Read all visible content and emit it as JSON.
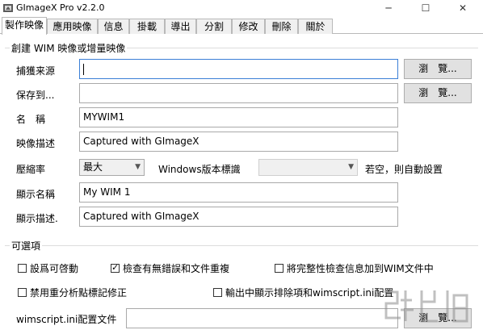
{
  "window": {
    "title": "GImageX Pro  v2.2.0",
    "minimize": "─",
    "maximize": "☐",
    "close": "✕"
  },
  "tabs": [
    "製作映像",
    "應用映像",
    "信息",
    "掛載",
    "導出",
    "分割",
    "修改",
    "刪除",
    "關於"
  ],
  "active_tab_index": 0,
  "create_group": {
    "title": "創建 WIM 映像或增量映像",
    "source": {
      "label": "捕獲来源",
      "value": "",
      "browse_label": "瀏　覽..."
    },
    "dest": {
      "label": "保存到...",
      "value": "",
      "browse_label": "瀏　覽..."
    },
    "name": {
      "label": "名　稱",
      "value": "MYWIM1"
    },
    "description": {
      "label": "映像描述",
      "value": "Captured with GImageX"
    },
    "compression": {
      "label": "壓縮率",
      "value": "最大"
    },
    "windows_version": {
      "label": "Windows版本標識",
      "value": "",
      "hint": "若空，則自動設置"
    },
    "display_name": {
      "label": "顯示名稱",
      "value": "My WIM 1"
    },
    "display_desc": {
      "label": "顯示描述.",
      "value": "Captured with GImageX"
    }
  },
  "options_group": {
    "title": "可選項",
    "bootable": {
      "label": "設爲可啓動",
      "checked": false
    },
    "check_errors": {
      "label": "檢查有無錯誤和文件重複",
      "checked": true
    },
    "integrity": {
      "label": "將完整性檢查信息加到WIM文件中",
      "checked": false
    },
    "no_reparse": {
      "label": "禁用重分析點標記修正",
      "checked": false
    },
    "show_excludes": {
      "label": "輸出中顯示排除項和wimscript.ini配置",
      "checked": false
    },
    "config_file": {
      "label": "wimscript.ini配置文件",
      "value": "",
      "browse_label": "瀏　覽..."
    }
  }
}
